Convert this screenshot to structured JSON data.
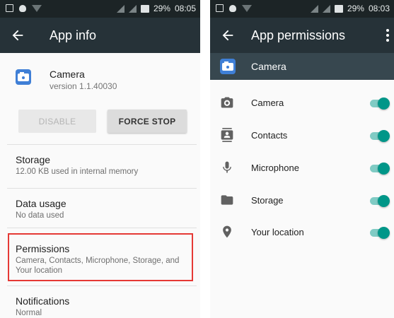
{
  "left": {
    "status": {
      "battery": "29%",
      "time": "08:05"
    },
    "appbar": {
      "title": "App info"
    },
    "app": {
      "name": "Camera",
      "version": "version 1.1.40030"
    },
    "buttons": {
      "disable": "DISABLE",
      "force_stop": "FORCE STOP"
    },
    "sections": [
      {
        "title": "Storage",
        "subtitle": "12.00 KB used in internal memory"
      },
      {
        "title": "Data usage",
        "subtitle": "No data used"
      },
      {
        "title": "Permissions",
        "subtitle": "Camera, Contacts, Microphone, Storage, and Your location"
      },
      {
        "title": "Notifications",
        "subtitle": "Normal"
      }
    ],
    "highlight_color": "#e53935"
  },
  "right": {
    "status": {
      "battery": "29%",
      "time": "08:03"
    },
    "appbar": {
      "title": "App permissions"
    },
    "app_row": {
      "label": "Camera"
    },
    "permissions": [
      {
        "label": "Camera",
        "icon": "camera-icon",
        "enabled": true
      },
      {
        "label": "Contacts",
        "icon": "contacts-icon",
        "enabled": true
      },
      {
        "label": "Microphone",
        "icon": "microphone-icon",
        "enabled": true
      },
      {
        "label": "Storage",
        "icon": "folder-icon",
        "enabled": true
      },
      {
        "label": "Your location",
        "icon": "location-pin-icon",
        "enabled": true
      }
    ],
    "accent_color": "#009688",
    "appbar_color": "#263238"
  }
}
